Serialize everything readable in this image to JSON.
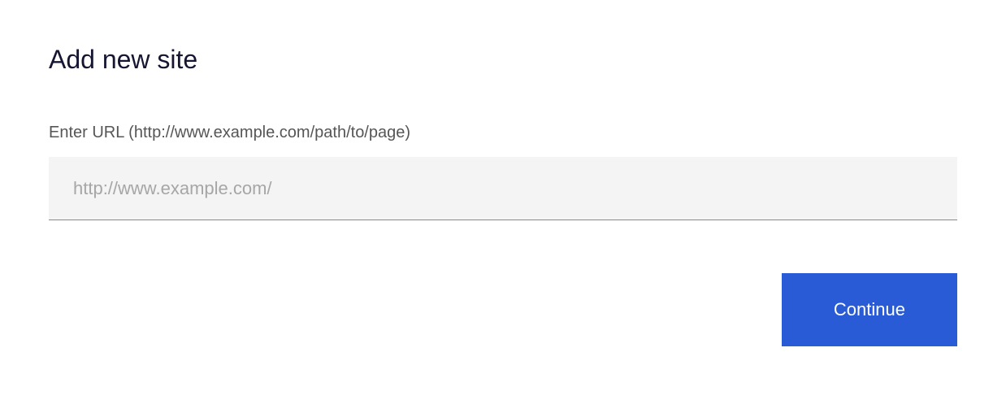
{
  "header": {
    "title": "Add new site"
  },
  "form": {
    "url_label": "Enter URL (http://www.example.com/path/to/page)",
    "url_placeholder": "http://www.example.com/",
    "url_value": ""
  },
  "actions": {
    "continue_label": "Continue"
  }
}
